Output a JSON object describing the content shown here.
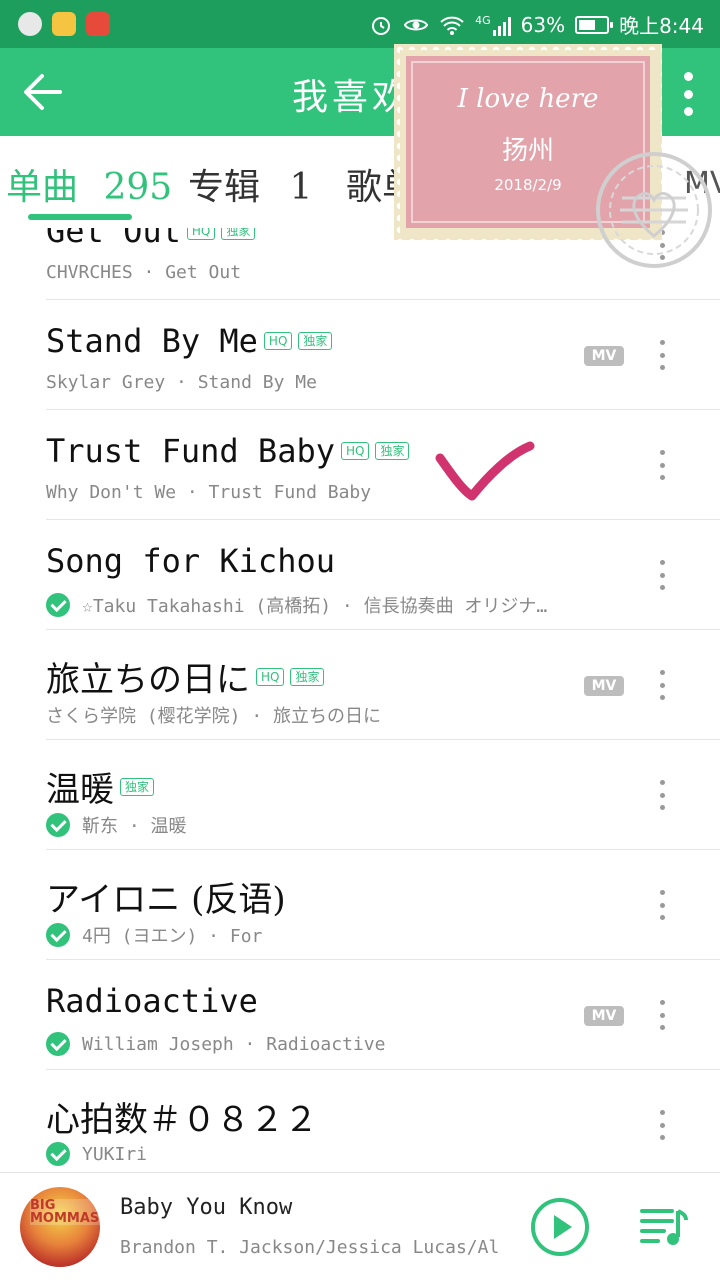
{
  "status_bar": {
    "network": "4G",
    "battery": "63%",
    "battery_level": 0.63,
    "time": "晚上8:44"
  },
  "header": {
    "title": "我喜欢"
  },
  "tabs": [
    {
      "label": "单曲",
      "count": "295",
      "active": true
    },
    {
      "label": "专辑",
      "count": "1",
      "active": false
    },
    {
      "label": "歌单",
      "count": "",
      "active": false
    },
    {
      "label": "MV",
      "count": "",
      "active": false
    }
  ],
  "songs": [
    {
      "title": "Get Out",
      "subtitle": "CHVRCHES · Get Out",
      "tags": [
        "HQ",
        "独家"
      ],
      "mv": false,
      "downloaded": false
    },
    {
      "title": "Stand By Me",
      "subtitle": "Skylar Grey · Stand By Me",
      "tags": [
        "HQ",
        "独家"
      ],
      "mv": true,
      "downloaded": false
    },
    {
      "title": "Trust Fund Baby",
      "subtitle": "Why Don't We · Trust Fund Baby",
      "tags": [
        "HQ",
        "独家"
      ],
      "mv": false,
      "downloaded": false
    },
    {
      "title": "Song for Kichou",
      "subtitle": "☆Taku Takahashi (高橋拓) · 信長協奏曲 オリジナ…",
      "tags": [],
      "mv": false,
      "downloaded": true
    },
    {
      "title": "旅立ちの日に",
      "subtitle": "さくら学院 (樱花学院) · 旅立ちの日に",
      "tags": [
        "HQ",
        "独家"
      ],
      "mv": true,
      "downloaded": false
    },
    {
      "title": "温暖",
      "subtitle": "靳东 · 温暖",
      "tags": [
        "独家"
      ],
      "mv": false,
      "downloaded": true
    },
    {
      "title": "アイロニ (反语)",
      "subtitle": "4円 (ヨエン) · For",
      "tags": [],
      "mv": false,
      "downloaded": true
    },
    {
      "title": "Radioactive",
      "subtitle": "William Joseph · Radioactive",
      "tags": [],
      "mv": true,
      "downloaded": true
    },
    {
      "title": "心拍数＃０８２２",
      "subtitle": "YUKIri",
      "tags": [],
      "mv": false,
      "downloaded": true
    }
  ],
  "mv_label": "MV",
  "now_playing": {
    "title": "Baby You Know",
    "artist": "Brandon T. Jackson/Jessica Lucas/Ala···",
    "cover_text": "BIG MOMMAS"
  },
  "stamp": {
    "line1": "I love here",
    "line2": "扬州",
    "date": "2018/2/9"
  },
  "colors": {
    "status_bar": "#1e9e5c",
    "app_bar": "#31c27c",
    "accent": "#31c27c",
    "checkmark_sticker": "#d0336d"
  }
}
